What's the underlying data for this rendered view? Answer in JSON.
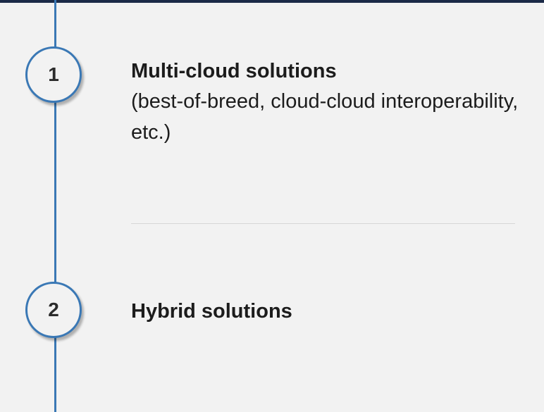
{
  "steps": [
    {
      "number": "1",
      "title": "Multi-cloud solutions",
      "description": "(best-of-breed, cloud-cloud interoperability, etc.)"
    },
    {
      "number": "2",
      "title": "Hybrid solutions"
    }
  ],
  "colors": {
    "accent": "#3a78b5",
    "top_bar": "#1b2a47",
    "background": "#f2f2f2",
    "text": "#1c1c1c"
  }
}
